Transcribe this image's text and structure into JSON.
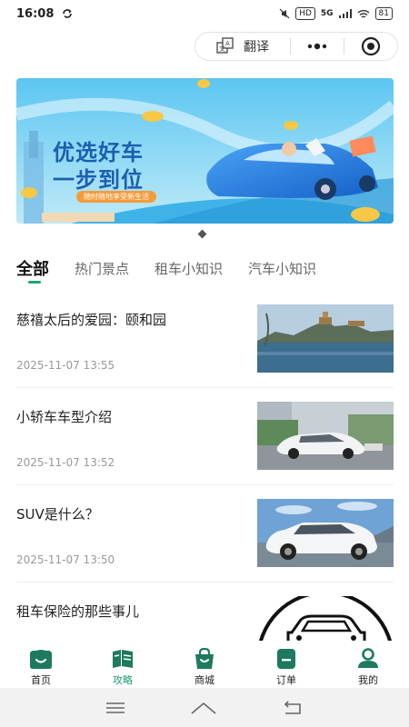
{
  "status_bar": {
    "time": "16:08",
    "hd": "HD",
    "network": "5G",
    "battery": "81"
  },
  "capsule": {
    "translate_label": "翻译"
  },
  "tabs": [
    {
      "label": "全部"
    },
    {
      "label": "热门景点"
    },
    {
      "label": "租车小知识"
    },
    {
      "label": "汽车小知识"
    }
  ],
  "banner": {
    "headline_1": "优选好车",
    "headline_2": "一步到位",
    "tagline": "随时随地享受新生活"
  },
  "articles": [
    {
      "title": "慈禧太后的爱园：颐和园",
      "date": "2025-11-07 13:55"
    },
    {
      "title": "小轿车车型介绍",
      "date": "2025-11-07 13:52"
    },
    {
      "title": "SUV是什么？",
      "date": "2025-11-07 13:50"
    },
    {
      "title": "租车保险的那些事儿",
      "date": ""
    }
  ],
  "bottom_nav": [
    {
      "label": "首页",
      "icon": "home-icon"
    },
    {
      "label": "攻略",
      "icon": "guide-icon"
    },
    {
      "label": "商城",
      "icon": "shop-icon"
    },
    {
      "label": "订单",
      "icon": "order-icon"
    },
    {
      "label": "我的",
      "icon": "profile-icon"
    }
  ],
  "colors": {
    "accent": "#1aa37c",
    "icon_dark": "#1d7a5e"
  }
}
